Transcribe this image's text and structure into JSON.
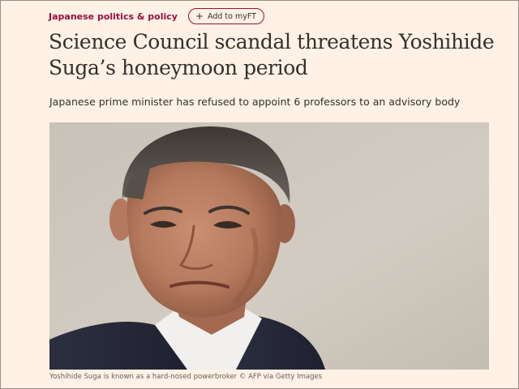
{
  "article": {
    "topic": "Japanese politics & policy",
    "myft_button": "Add to myFT",
    "headline": "Science Council scandal threatens Yoshihide Suga’s honeymoon period",
    "standfirst": "Japanese prime minister has refused to appoint 6 professors to an advisory body",
    "caption": "Yoshihide Suga is known as a hard-nosed powerbroker © AFP via Getty Images"
  },
  "icons": {
    "myft": "plus-icon"
  },
  "colors": {
    "background": "#fff1e5",
    "accent": "#990f3d",
    "text": "#33302e",
    "caption": "#66605c"
  }
}
